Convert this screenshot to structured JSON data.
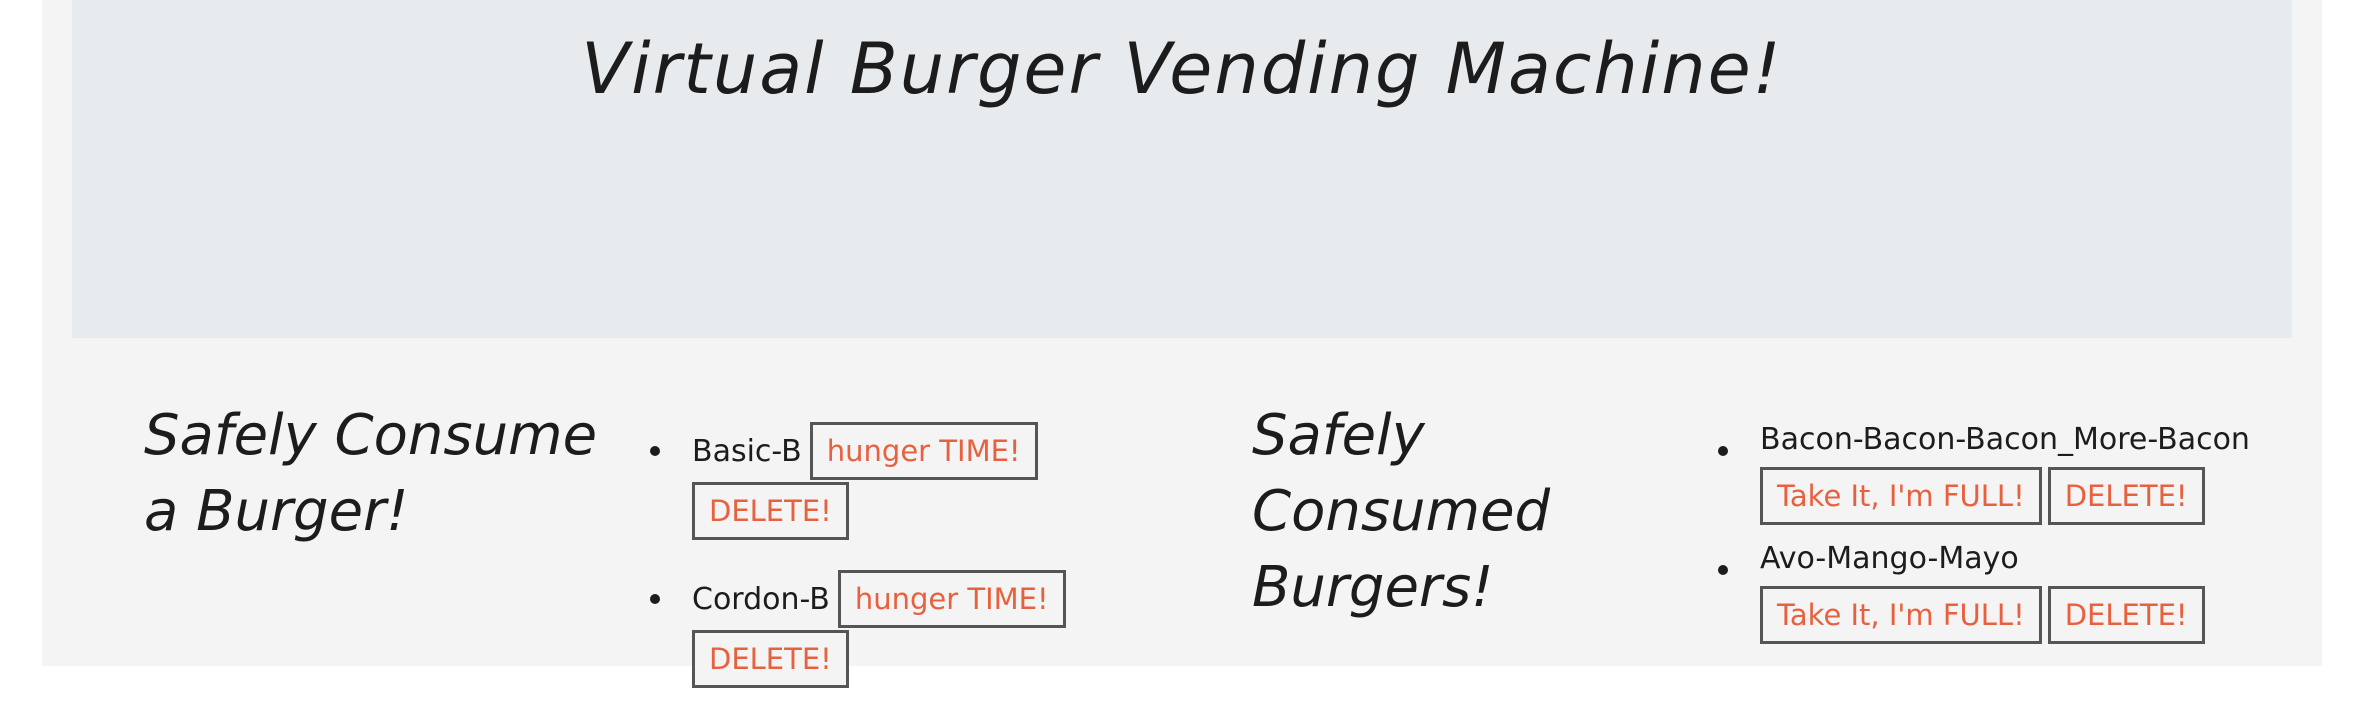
{
  "header": {
    "title": "Virtual Burger Vending Machine!"
  },
  "left_column": {
    "heading": "Safely Consume a Burger!",
    "items": [
      {
        "name": "Basic-B",
        "primary_button": "hunger TIME!",
        "delete_button": "DELETE!"
      },
      {
        "name": "Cordon-B",
        "primary_button": "hunger TIME!",
        "delete_button": "DELETE!"
      }
    ]
  },
  "right_column": {
    "heading": "Safely Consumed Burgers!",
    "items": [
      {
        "name": "Bacon-Bacon-Bacon_More-Bacon",
        "primary_button": "Take It, I'm FULL!",
        "delete_button": "DELETE!"
      },
      {
        "name": "Avo-Mango-Mayo",
        "primary_button": "Take It, I'm FULL!",
        "delete_button": "DELETE!"
      }
    ]
  },
  "colors": {
    "button_text": "#e8613f",
    "jumbotron_bg": "#e8ebee",
    "page_bg": "#f4f4f4"
  }
}
